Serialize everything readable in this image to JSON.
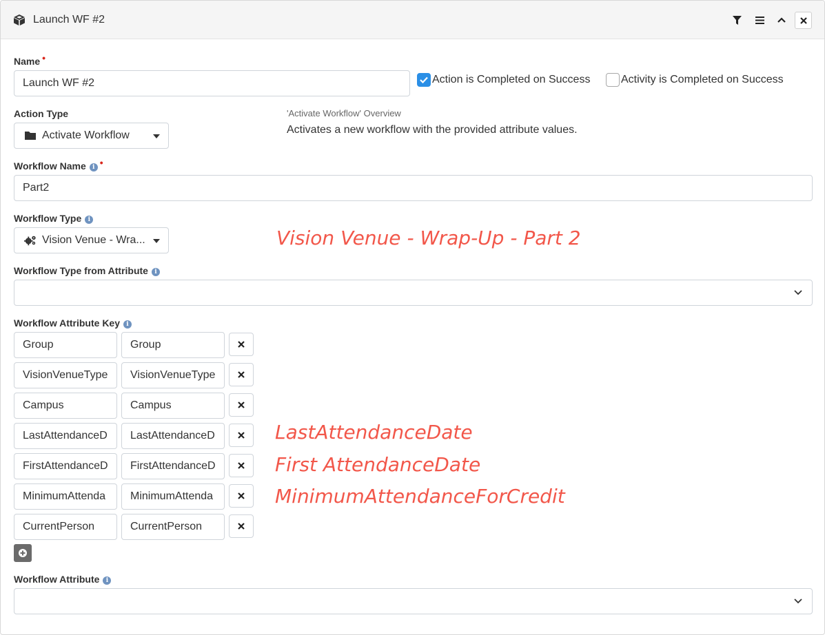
{
  "header": {
    "title": "Launch WF #2",
    "icons": [
      "cube-icon",
      "filter-icon",
      "menu-icon",
      "chevron-up-icon",
      "close-icon"
    ]
  },
  "form": {
    "name": {
      "label": "Name",
      "required_mark": "•",
      "value": "Launch WF #2"
    },
    "action_completed": {
      "label": "Action is Completed on Success",
      "checked": true
    },
    "activity_completed": {
      "label": "Activity is Completed on Success",
      "checked": false
    },
    "action_type": {
      "label": "Action Type",
      "value": "Activate Workflow",
      "icon": "folder-icon"
    },
    "overview": {
      "title": "'Activate Workflow' Overview",
      "description": "Activates a new workflow with the provided attribute values."
    },
    "workflow_name": {
      "label": "Workflow Name",
      "required_mark": "•",
      "value": "Part2"
    },
    "workflow_type": {
      "label": "Workflow Type",
      "value": "Vision Venue - Wra...",
      "icon": "cogs-icon"
    },
    "workflow_type_from_attribute": {
      "label": "Workflow Type from Attribute",
      "value": ""
    },
    "workflow_attribute_key": {
      "label": "Workflow Attribute Key",
      "rows": [
        {
          "key": "Group",
          "value": "Group"
        },
        {
          "key": "VisionVenueType",
          "value": "VisionVenueType"
        },
        {
          "key": "Campus",
          "value": "Campus"
        },
        {
          "key": "LastAttendanceD",
          "value": "LastAttendanceD"
        },
        {
          "key": "FirstAttendanceD",
          "value": "FirstAttendanceD"
        },
        {
          "key": "MinimumAttenda",
          "value": "MinimumAttenda"
        },
        {
          "key": "CurrentPerson",
          "value": "CurrentPerson"
        }
      ]
    },
    "workflow_attribute": {
      "label": "Workflow Attribute",
      "value": ""
    }
  },
  "annotations": {
    "workflow_type": "Vision Venue - Wrap-Up - Part 2",
    "last_attendance": "LastAttendanceDate",
    "first_attendance": "First AttendanceDate",
    "minimum_attendance": "MinimumAttendanceForCredit"
  },
  "colors": {
    "accent": "#2b8fe6",
    "annotation": "#f2574a",
    "required": "#d9261c",
    "info": "#6f93c0"
  }
}
